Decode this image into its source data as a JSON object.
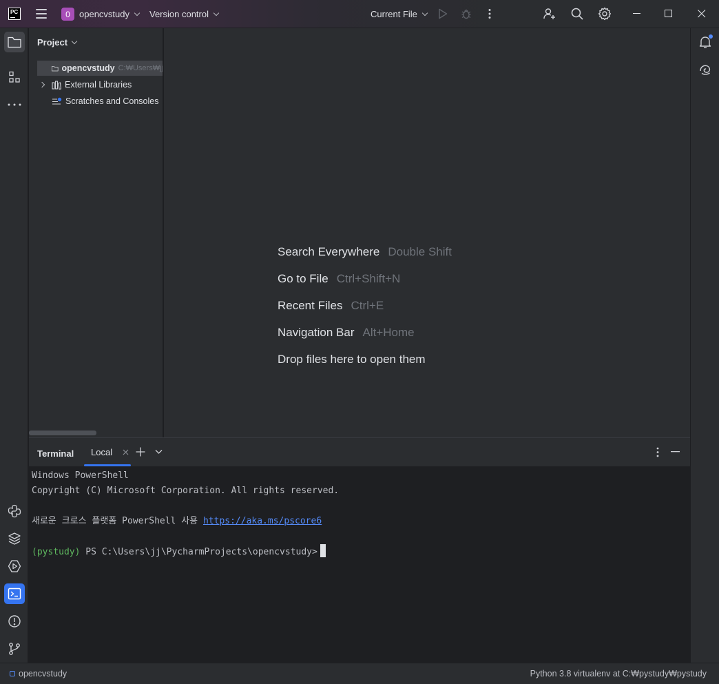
{
  "titlebar": {
    "app_logo_text": "PC",
    "project_badge": "0",
    "project_name": "opencvstudy",
    "vcs_label": "Version control",
    "run_config": "Current File"
  },
  "project_panel": {
    "title": "Project",
    "tree": [
      {
        "label": "opencvstudy",
        "path": "C:₩Users₩jj",
        "selected": true
      },
      {
        "label": "External Libraries"
      },
      {
        "label": "Scratches and Consoles"
      }
    ]
  },
  "editor": {
    "hints": [
      {
        "action": "Search Everywhere",
        "key": "Double Shift"
      },
      {
        "action": "Go to File",
        "key": "Ctrl+Shift+N"
      },
      {
        "action": "Recent Files",
        "key": "Ctrl+E"
      },
      {
        "action": "Navigation Bar",
        "key": "Alt+Home"
      },
      {
        "action": "Drop files here to open them",
        "key": ""
      }
    ]
  },
  "terminal": {
    "title": "Terminal",
    "tab_label": "Local",
    "lines": {
      "l1": "Windows PowerShell",
      "l2": "Copyright (C) Microsoft Corporation. All rights reserved.",
      "l3_prefix": "새로운 크로스 플랫폼 PowerShell 사용 ",
      "l3_link": "https://aka.ms/pscore6",
      "env": "(pystudy)",
      "prompt": " PS C:\\Users\\jj\\PycharmProjects\\opencvstudy>"
    }
  },
  "statusbar": {
    "project": "opencvstudy",
    "interpreter": "Python 3.8 virtualenv at C:₩pystudy₩pystudy"
  },
  "colors": {
    "accent": "#3574f0",
    "badge": "#a84eb8",
    "link": "#548af7",
    "env": "#5fb85f"
  }
}
